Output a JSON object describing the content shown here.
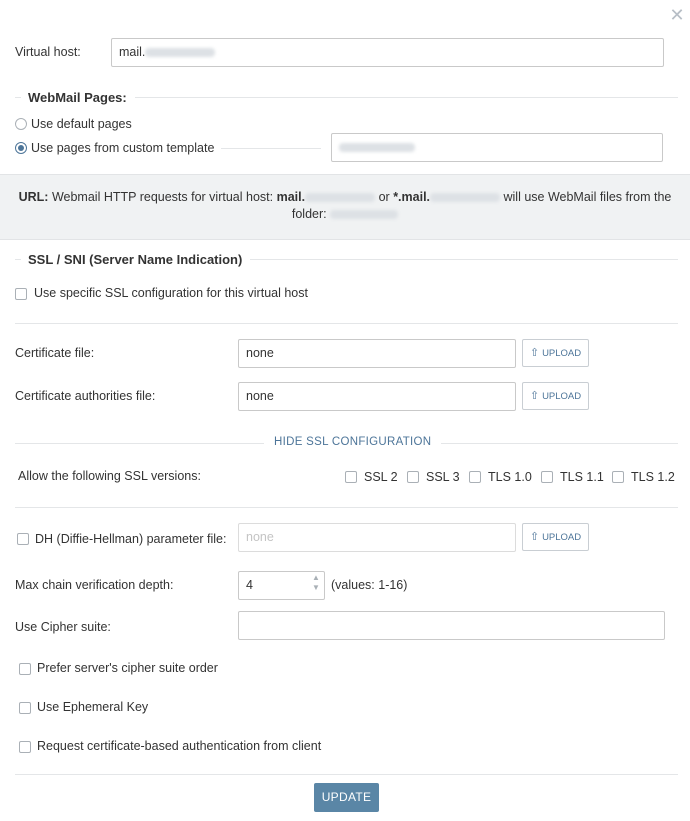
{
  "dialog": {
    "close_glyph": "✕"
  },
  "virtual_host": {
    "label": "Virtual host:",
    "value_prefix": "mail."
  },
  "webmail": {
    "heading": "WebMail Pages:",
    "option_default": "Use default pages",
    "option_custom": "Use pages from custom template",
    "selected": "custom"
  },
  "url_info": {
    "label": "URL:",
    "text_before": "Webmail HTTP requests for virtual host:",
    "host_prefix": "mail.",
    "or_text": "or",
    "wildcard_prefix": "*.mail.",
    "text_after": "will use WebMail files from the",
    "folder_text": "folder:"
  },
  "ssl": {
    "heading": "SSL / SNI (Server Name Indication)",
    "use_specific": "Use specific SSL configuration for this virtual host",
    "cert_label": "Certificate file:",
    "cert_value": "none",
    "ca_label": "Certificate authorities file:",
    "ca_value": "none",
    "upload_label": "UPLOAD",
    "hide_config": "HIDE SSL CONFIGURATION",
    "versions_label": "Allow the following SSL versions:",
    "versions": [
      "SSL 2",
      "SSL 3",
      "TLS 1.0",
      "TLS 1.1",
      "TLS 1.2"
    ],
    "dh_label": "DH (Diffie-Hellman) parameter file:",
    "dh_placeholder": "none",
    "depth_label": "Max chain verification depth:",
    "depth_value": "4",
    "depth_hint": "(values: 1-16)",
    "cipher_label": "Use Cipher suite:",
    "cipher_value": "",
    "prefer_server": "Prefer server's cipher suite order",
    "ephemeral": "Use Ephemeral Key",
    "client_auth": "Request certificate-based authentication from client"
  },
  "actions": {
    "update": "UPDATE"
  },
  "colors": {
    "accent": "#4d7599",
    "button": "#5a86a6",
    "band": "#f0f2f3"
  }
}
